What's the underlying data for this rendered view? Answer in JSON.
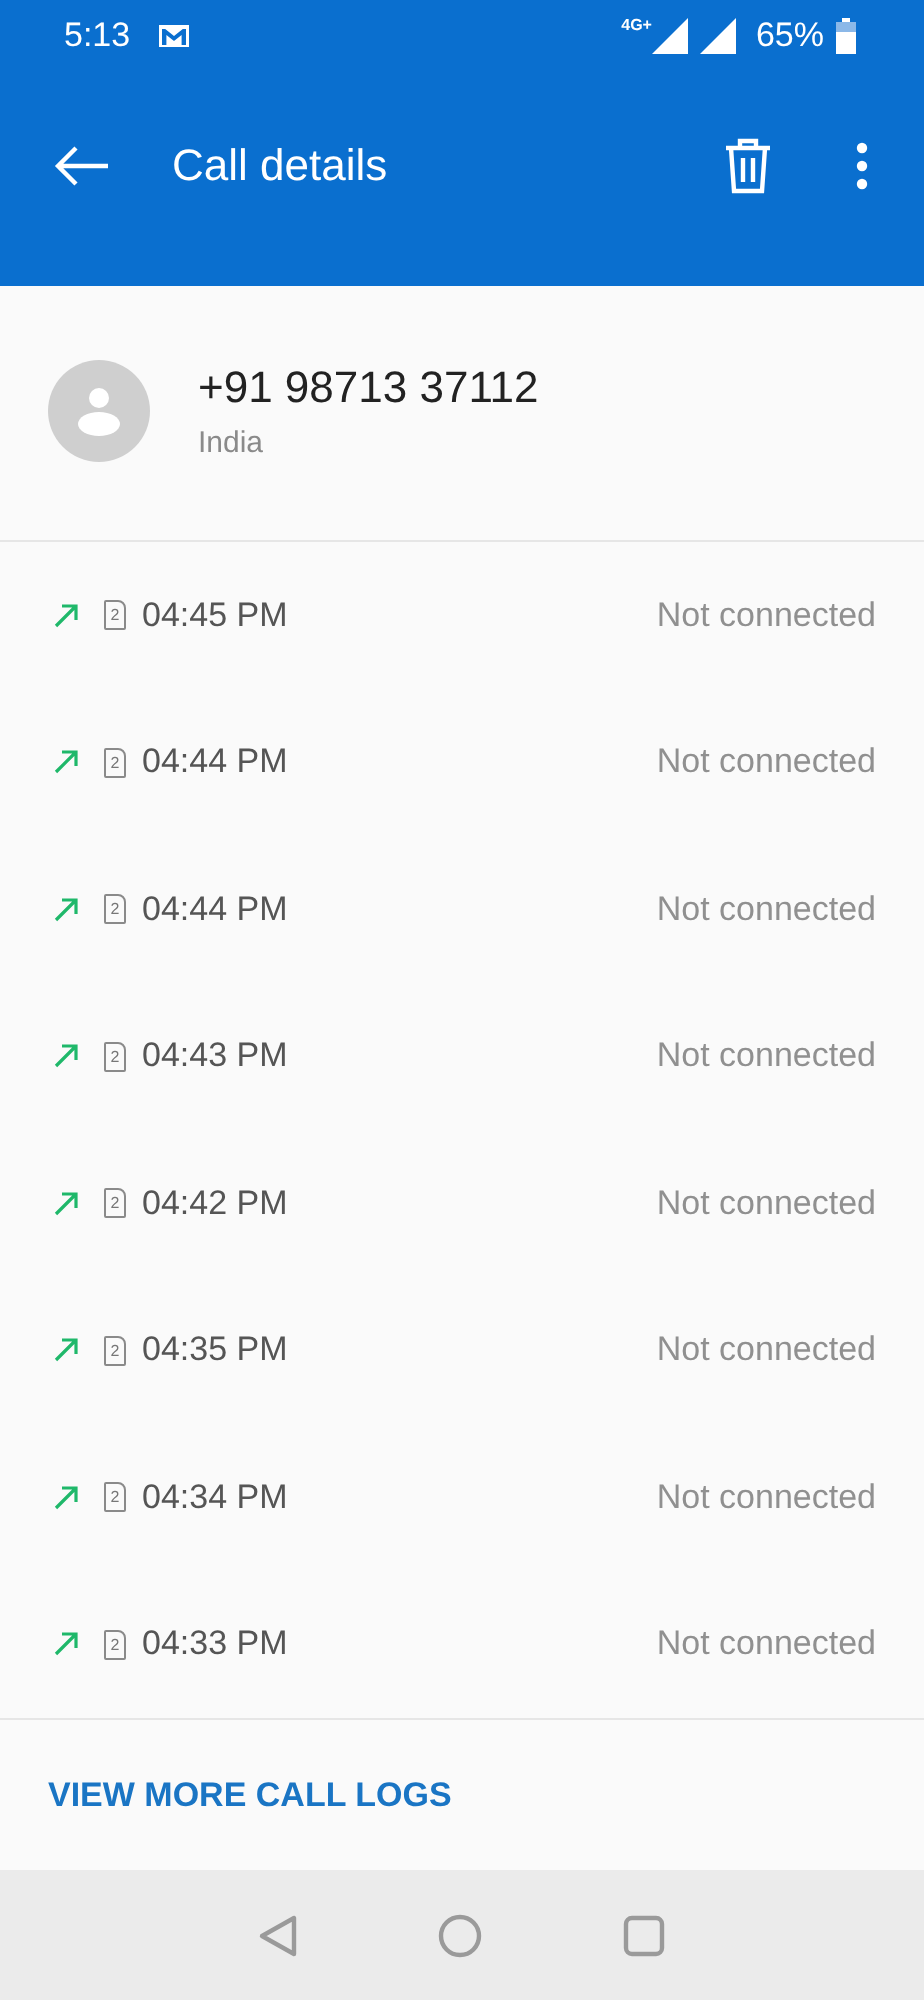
{
  "status_bar": {
    "time": "5:13",
    "network": "4G+",
    "battery": "65%"
  },
  "app_bar": {
    "title": "Call details"
  },
  "contact": {
    "number": "+91 98713 37112",
    "location": "India"
  },
  "calls": [
    {
      "kind": "outgoing",
      "sim": "2",
      "time": "04:45 PM",
      "status": "Not connected"
    },
    {
      "kind": "outgoing",
      "sim": "2",
      "time": "04:44 PM",
      "status": "Not connected"
    },
    {
      "kind": "outgoing",
      "sim": "2",
      "time": "04:44 PM",
      "status": "Not connected"
    },
    {
      "kind": "outgoing",
      "sim": "2",
      "time": "04:43 PM",
      "status": "Not connected"
    },
    {
      "kind": "outgoing",
      "sim": "2",
      "time": "04:42 PM",
      "status": "Not connected"
    },
    {
      "kind": "outgoing",
      "sim": "2",
      "time": "04:35 PM",
      "status": "Not connected"
    },
    {
      "kind": "outgoing",
      "sim": "2",
      "time": "04:34 PM",
      "status": "Not connected"
    },
    {
      "kind": "outgoing",
      "sim": "2",
      "time": "04:33 PM",
      "status": "Not connected"
    }
  ],
  "more_button": "VIEW MORE CALL LOGS"
}
